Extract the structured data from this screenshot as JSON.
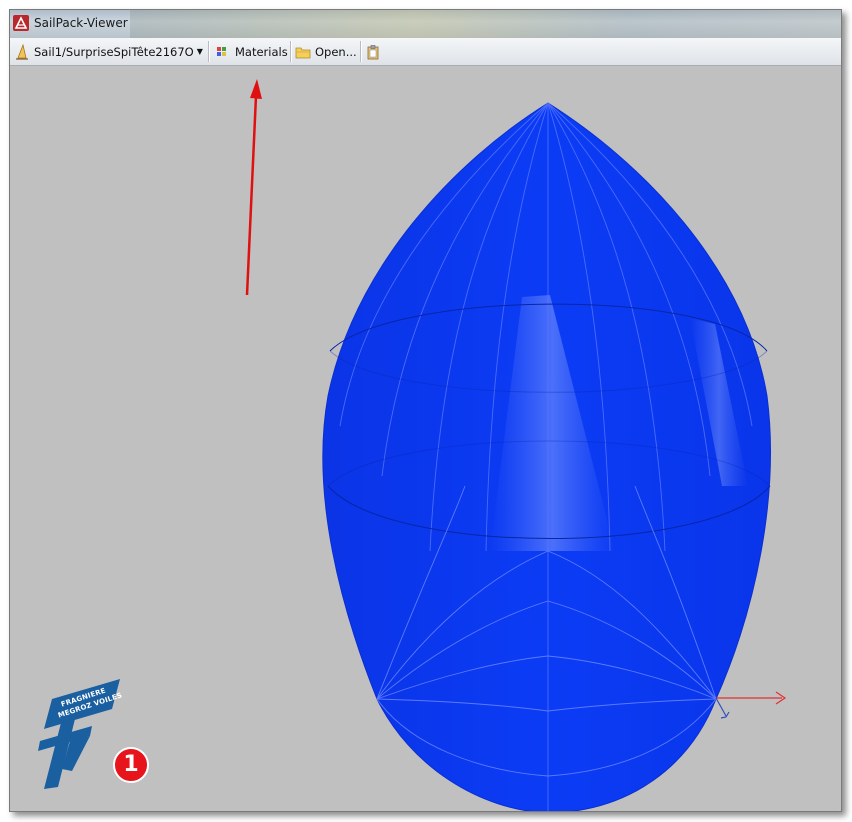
{
  "window": {
    "title": "SailPack-Viewer",
    "icon": "sailpack-app-icon"
  },
  "toolbar": {
    "sail_selector": {
      "label": "Sail1/SurpriseSpiTête2167O",
      "icon": "sail-icon"
    },
    "materials": {
      "label": "Materials",
      "icon": "palette-icon"
    },
    "open": {
      "label": "Open...",
      "icon": "folder-icon"
    },
    "clipboard": {
      "icon": "clipboard-icon"
    }
  },
  "viewport": {
    "sail_color": "#0b3cf5",
    "background": "#c0c0c0",
    "annotation_arrow_color": "#e01010",
    "axis_x_color": "#e03030",
    "axis_z_color": "#3050c0"
  },
  "logo": {
    "line1": "FRAGNIERE",
    "line2": "MEGROZ VOILES",
    "color": "#1a5fa0"
  },
  "step_badge": {
    "number": "1",
    "color": "#e8141b"
  }
}
